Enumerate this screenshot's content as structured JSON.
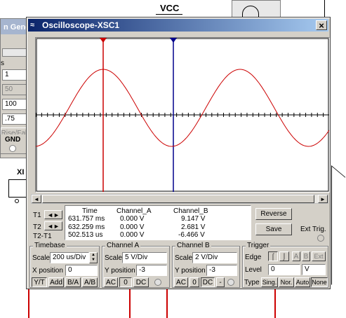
{
  "schematic": {
    "vcc_label": "VCC",
    "generator_title": "n Gener",
    "gen_field1": "1",
    "gen_field2": "50",
    "gen_field3": "100",
    "gen_field4": ".75",
    "rise_fall": "Rise/Fall",
    "gnd_label": "GND",
    "xb_label": "XI",
    "partial_s": "s"
  },
  "window": {
    "title": "Oscilloscope-XSC1",
    "close_glyph": "×"
  },
  "readout": {
    "headers": [
      "Time",
      "Channel_A",
      "Channel_B"
    ],
    "rows": [
      {
        "label": "T1",
        "time": "631.757 ms",
        "a": "0.000 V",
        "b": "9.147 V"
      },
      {
        "label": "T2",
        "time": "632.259 ms",
        "a": "0.000 V",
        "b": "2.681 V"
      },
      {
        "label": "T2-T1",
        "time": "502.513 us",
        "a": "0.000 V",
        "b": "-6.466 V"
      }
    ],
    "arrows": "◄►"
  },
  "buttons": {
    "reverse": "Reverse",
    "save": "Save",
    "ext_trig": "Ext Trig."
  },
  "timebase": {
    "label": "Timebase",
    "scale_label": "Scale",
    "scale_value": "200 us/Div",
    "xpos_label": "X position",
    "xpos_value": "0",
    "modes": [
      "Y/T",
      "Add",
      "B/A",
      "A/B"
    ]
  },
  "channel_a": {
    "label": "Channel A",
    "scale_label": "Scale",
    "scale_value": "5  V/Div",
    "ypos_label": "Y position",
    "ypos_value": "-3",
    "coupling": [
      "AC",
      "0",
      "DC"
    ]
  },
  "channel_b": {
    "label": "Channel B",
    "scale_label": "Scale",
    "scale_value": "2  V/Div",
    "ypos_label": "Y position",
    "ypos_value": "-3",
    "coupling": [
      "AC",
      "0",
      "DC",
      "-"
    ]
  },
  "trigger": {
    "label": "Trigger",
    "edge_label": "Edge",
    "level_label": "Level",
    "level_value": "0",
    "level_unit": "V",
    "source": [
      "A",
      "B",
      "Ext"
    ],
    "type_label": "Type",
    "types": [
      "Sing.",
      "Nor.",
      "Auto",
      "None"
    ]
  },
  "colors": {
    "trace_b": "#cc0000",
    "cursor_t1": "#cc0000",
    "cursor_t2": "#00008b",
    "grid": "#808080"
  }
}
